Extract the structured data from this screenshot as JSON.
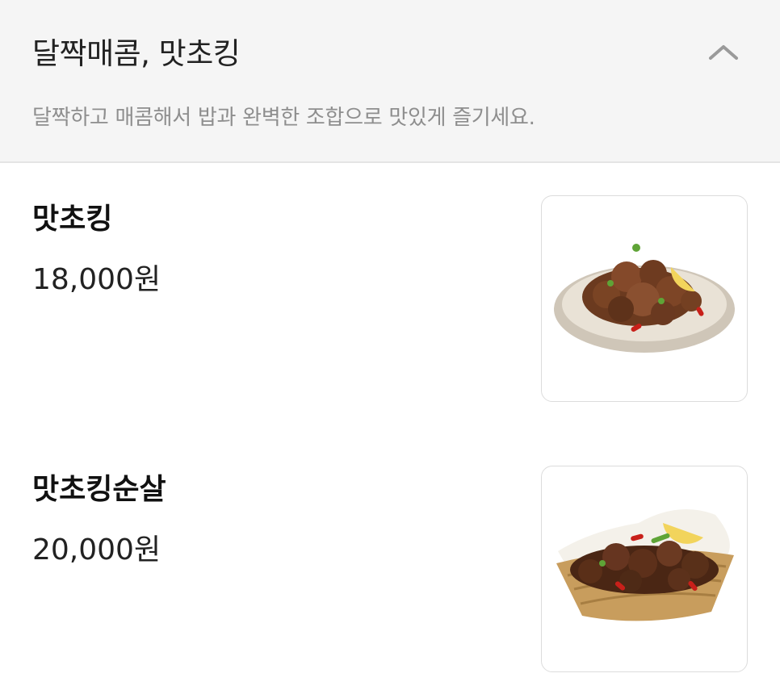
{
  "category": {
    "title": "달짝매콤, 맛초킹",
    "description": "달짝하고 매콤해서 밥과 완벽한 조합으로 맛있게 즐기세요.",
    "toggle_icon": "chevron-up-icon"
  },
  "menu": {
    "items": [
      {
        "name": "맛초킹",
        "price": "18,000원",
        "image": "chicken-plate-image"
      },
      {
        "name": "맛초킹순살",
        "price": "20,000원",
        "image": "boneless-chicken-basket-image"
      }
    ]
  },
  "colors": {
    "header_bg": "#f5f5f5",
    "divider": "#e4e4e4",
    "text_primary": "#222222",
    "text_secondary": "#8e8e8e"
  }
}
